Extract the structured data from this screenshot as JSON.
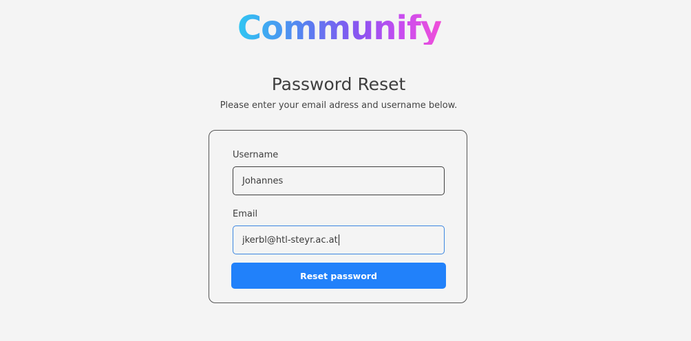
{
  "logo": {
    "text": "Communify"
  },
  "header": {
    "title": "Password Reset",
    "subtitle": "Please enter your email adress and username below."
  },
  "form": {
    "username": {
      "label": "Username",
      "value": "Johannes"
    },
    "email": {
      "label": "Email",
      "value": "jkerbl@htl-steyr.ac.at"
    },
    "submit_label": "Reset password"
  },
  "colors": {
    "background": "#f4f4f4",
    "accent": "#2181fa",
    "focus_border": "#3b86e0",
    "logo_gradient_start": "#2fc6f2",
    "logo_gradient_end": "#f04fd9"
  }
}
